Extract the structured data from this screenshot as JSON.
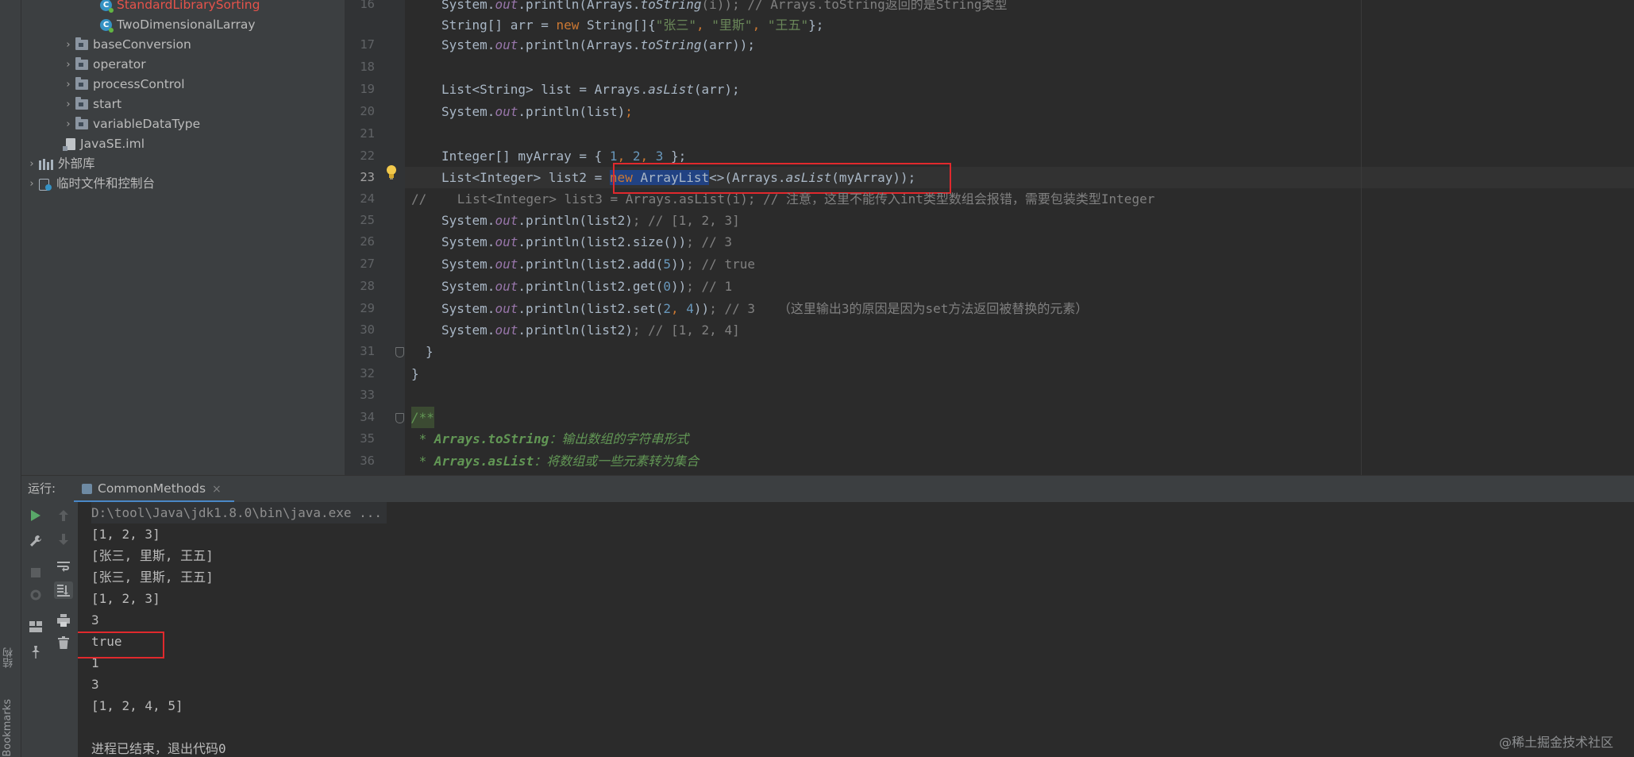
{
  "sidebar": {
    "left_labels": [
      "结构",
      "Bookmarks"
    ]
  },
  "project_tree": [
    {
      "label": "StandardLibrarySorting",
      "kind": "class",
      "color": "#e5534b"
    },
    {
      "label": "TwoDimensionalLarray",
      "kind": "class",
      "color": "#bbbbbb"
    },
    {
      "label": "baseConversion",
      "kind": "folder"
    },
    {
      "label": "operator",
      "kind": "folder"
    },
    {
      "label": "processControl",
      "kind": "folder"
    },
    {
      "label": "start",
      "kind": "folder"
    },
    {
      "label": "variableDataType",
      "kind": "folder"
    },
    {
      "label": "JavaSE.iml",
      "kind": "file"
    },
    {
      "label": "外部库",
      "kind": "library"
    },
    {
      "label": "临时文件和控制台",
      "kind": "scratch"
    }
  ],
  "editor": {
    "line_numbers": [
      "16",
      "17",
      "18",
      "19",
      "20",
      "21",
      "22",
      "23",
      "24",
      "25",
      "26",
      "27",
      "28",
      "29",
      "30",
      "31",
      "32",
      "33",
      "34",
      "35",
      "36"
    ],
    "current_line": "23",
    "lines": {
      "l15a": "System.",
      "l15b": "out",
      "l15c": ".println(Arrays.",
      "l15d": "toString",
      "l15e": "(i)); // Arrays.toString返回的是String类型",
      "l16a": "String[] arr = ",
      "l16b": "new",
      "l16c": " String[]{",
      "l16d": "\"张三\"",
      "l16e": ", ",
      "l16f": "\"里斯\"",
      "l16g": ", ",
      "l16h": "\"王五\"",
      "l16i": "};",
      "l17a": "System.",
      "l17b": "out",
      "l17c": ".println(Arrays.",
      "l17d": "toString",
      "l17e": "(arr));",
      "l19a": "List<String> list = Arrays.",
      "l19b": "asList",
      "l19c": "(arr);",
      "l20a": "System.",
      "l20b": "out",
      "l20c": ".println(list)",
      "l20d": ";",
      "l22a": "Integer[] myArray = { ",
      "l22b": "1",
      "l22c": ", ",
      "l22d": "2",
      "l22e": ", ",
      "l22f": "3",
      "l22g": " };",
      "l23a": "List<Integer> list2 = ",
      "l23b": "new",
      "l23c": " ArrayList",
      "l23d": "<>(Arrays.",
      "l23e": "asList",
      "l23f": "(myArray));",
      "l24": "//    List<Integer> list3 = Arrays.asList(i); // 注意，这里不能传入int类型数组会报错，需要包装类型Integer",
      "l25a": "System.",
      "l25b": "out",
      "l25c": ".println(list2)",
      "l25d": "; // [1, 2, 3]",
      "l26a": "System.",
      "l26b": "out",
      "l26c": ".println(list2.size())",
      "l26d": "; // 3",
      "l27a": "System.",
      "l27b": "out",
      "l27c": ".println(list2.add(",
      "l27d": "5",
      "l27e": "))",
      "l27f": "; // true",
      "l28a": "System.",
      "l28b": "out",
      "l28c": ".println(list2.get(",
      "l28d": "0",
      "l28e": "))",
      "l28f": "; // 1",
      "l29a": "System.",
      "l29b": "out",
      "l29c": ".println(list2.set(",
      "l29d": "2",
      "l29e": ", ",
      "l29f": "4",
      "l29g": "))",
      "l29h": "; // 3   （这里输出3的原因是因为set方法返回被替换的元素）",
      "l30a": "System.",
      "l30b": "out",
      "l30c": ".println(list2)",
      "l30d": "; // [1, 2, 4]",
      "l31": "}",
      "l32": "}",
      "l34": "/**",
      "l35a": " * ",
      "l35b": "Arrays.toString",
      "l35c": "：输出数组的字符串形式",
      "l36a": " * ",
      "l36b": "Arrays.asList",
      "l36c": "：将数组或一些元素转为集合"
    }
  },
  "run_panel": {
    "label": "运行:",
    "tab": "CommonMethods",
    "tab_close": "×",
    "output": [
      "D:\\tool\\Java\\jdk1.8.0\\bin\\java.exe ...",
      "[1, 2, 3]",
      "[张三, 里斯, 王五]",
      "[张三, 里斯, 王五]",
      "[1, 2, 3]",
      "3",
      "true",
      "1",
      "3",
      "[1, 2, 4, 5]",
      "",
      "进程已结束，退出代码0"
    ]
  },
  "watermark": "@稀土掘金技术社区",
  "colors": {
    "highlight_box": "#e0292d",
    "selection": "#214283",
    "keyword": "#cc7832",
    "string": "#6a8759",
    "number": "#6897bb"
  }
}
